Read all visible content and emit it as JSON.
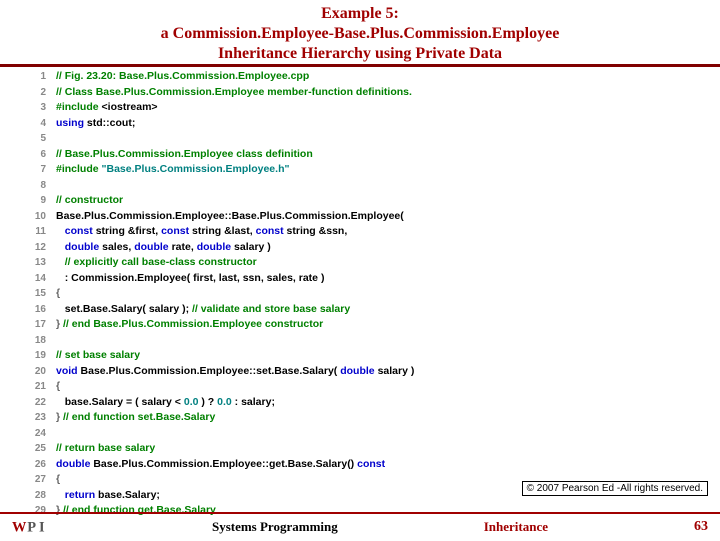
{
  "title": {
    "l1": "Example 5:",
    "l2": "a Commission.Employee-Base.Plus.Commission.Employee",
    "l3": "Inheritance Hierarchy using Private Data"
  },
  "code": {
    "file_comment": "// Fig. 23.20: Base.Plus.Commission.Employee.cpp",
    "class_comment": "// Class Base.Plus.Commission.Employee member-function definitions.",
    "include1": "#include",
    "inc1_arg": "<iostream>",
    "using_kw": "using",
    "using_ident": "std::cout;",
    "classdef_comment": "// Base.Plus.Commission.Employee class definition",
    "include2": "#include",
    "inc2_str": "\"Base.Plus.Commission.Employee.h\"",
    "ctor_comment": "// constructor",
    "ctor_head": "Base.Plus.Commission.Employee::Base.Plus.Commission.Employee(",
    "kw_const": "const",
    "ty_string": "string",
    "amp_first": "&first,",
    "amp_last": "&last,",
    "amp_ssn": "&ssn,",
    "ty_double": "double",
    "sales": "sales,",
    "rate": "rate,",
    "salary": "salary )",
    "explicit_comment": "// explicitly call base-class constructor",
    "init": ": Commission.Employee( first, last, ssn, sales, rate )",
    "brace_open": "{",
    "set_call": "set.Base.Salary( salary );",
    "set_comment": "// validate and store base salary",
    "brace_close": "}",
    "end_ctor_comment": "// end Base.Plus.Commission.Employee constructor",
    "setbase_comment": "// set base salary",
    "kw_void": "void",
    "setbase_head": "Base.Plus.Commission.Employee::set.Base.Salary(",
    "salary2": "salary )",
    "assign_pre": "base.Salary = ( salary < ",
    "zero1": "0.0",
    "assign_mid": " ) ? ",
    "zero2": "0.0",
    "assign_post": " : salary;",
    "end_set_comment": "// end function set.Base.Salary",
    "getbase_comment": "// return base salary",
    "getbase_head": "Base.Plus.Commission.Employee::get.Base.Salary()",
    "kw_return": "return",
    "ret_ident": "base.Salary;",
    "end_get_comment": "// end function get.Base.Salary"
  },
  "copyright": "© 2007 Pearson Ed -All rights reserved.",
  "footer": {
    "left": "Systems Programming",
    "mid": "Inheritance",
    "page": "63"
  }
}
